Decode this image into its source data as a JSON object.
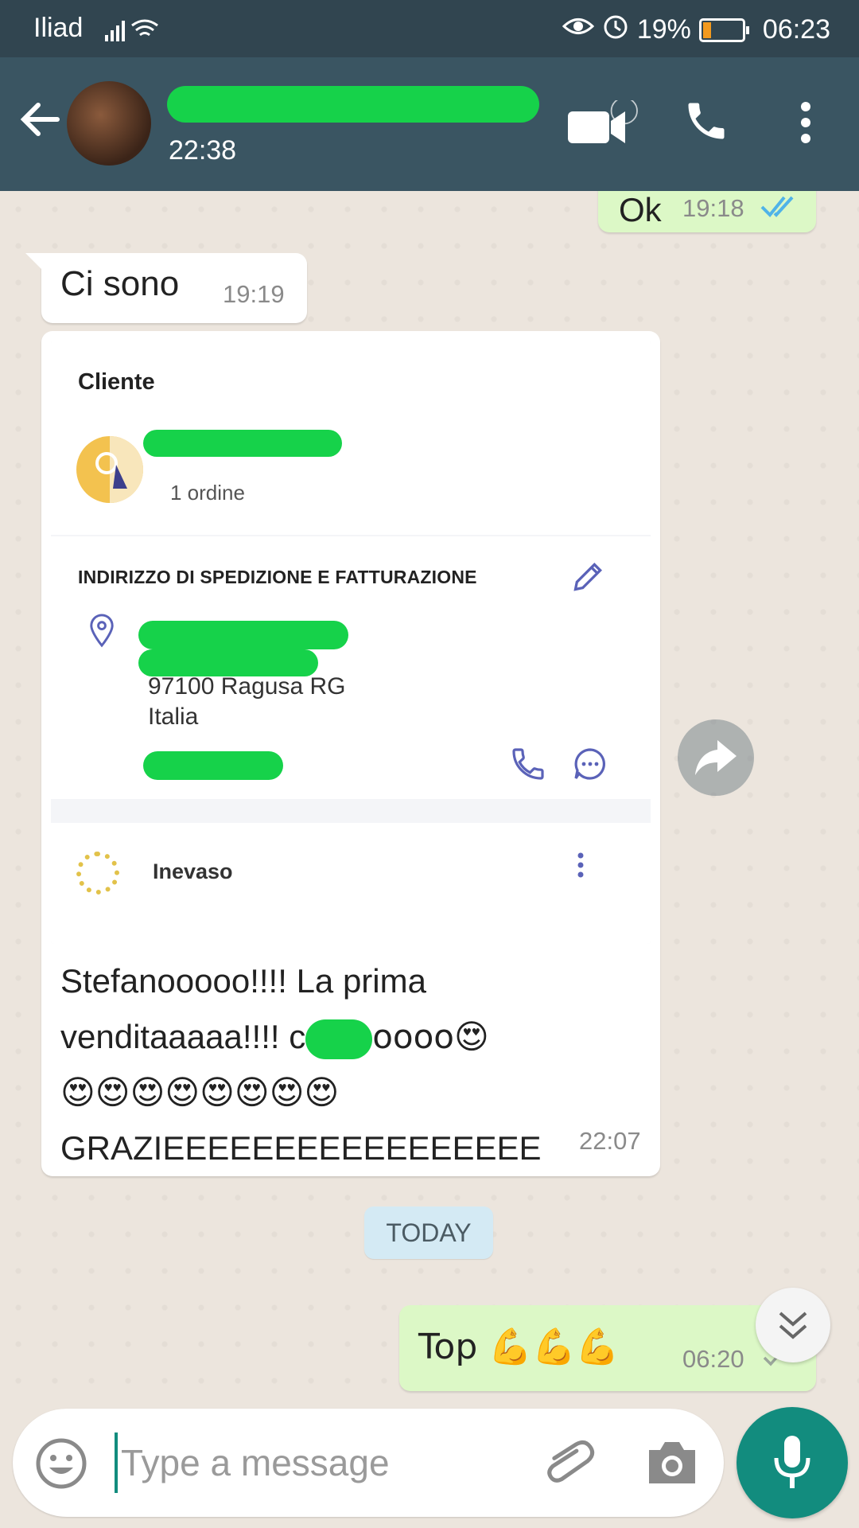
{
  "status_bar": {
    "carrier": "Iliad",
    "battery": "19%",
    "time": "06:23",
    "battery_level_pct": 19,
    "icons": [
      "signal-icon",
      "wifi-icon",
      "eye-icon",
      "alarm-icon",
      "battery-icon"
    ]
  },
  "header": {
    "contact_name": "",
    "last_seen": "22:38",
    "icons": [
      "back-arrow-icon",
      "video-call-icon",
      "phone-icon",
      "more-vert-icon"
    ]
  },
  "messages": [
    {
      "direction": "out",
      "text": "Ok",
      "time": "19:18",
      "status": "read"
    },
    {
      "direction": "in",
      "text": "Ci sono",
      "time": "19:19"
    },
    {
      "direction": "in",
      "time": "22:07",
      "card": {
        "title": "Cliente",
        "orders": "1 ordine",
        "address_heading": "INDIRIZZO DI SPEDIZIONE E FATTURAZIONE",
        "address_line_city": "97100 Ragusa RG",
        "address_line_country": "Italia",
        "status": "Inevaso"
      },
      "text_line1": "Stefanooooo!!!! La prima",
      "text_line2_a": "venditaaaaa!!!! c",
      "text_line2_b": "oooo😍",
      "text_line3": "😍😍😍😍😍😍😍😍",
      "text_line4": "GRAZIEEEEEEEEEEEEEEEEE"
    },
    {
      "direction": "out",
      "text": "Top 💪💪💪",
      "time": "06:20",
      "status": "sent"
    }
  ],
  "date_divider": "TODAY",
  "composer": {
    "placeholder": "Type a message",
    "value": ""
  },
  "colors": {
    "header_bg": "#3a5562",
    "status_bar_bg": "#314550",
    "chat_bg": "#ece5dd",
    "outgoing_bubble": "#dcf8c6",
    "accent": "#128c7e",
    "read_ticks": "#4fb3e8",
    "redaction": "#16d24a"
  }
}
